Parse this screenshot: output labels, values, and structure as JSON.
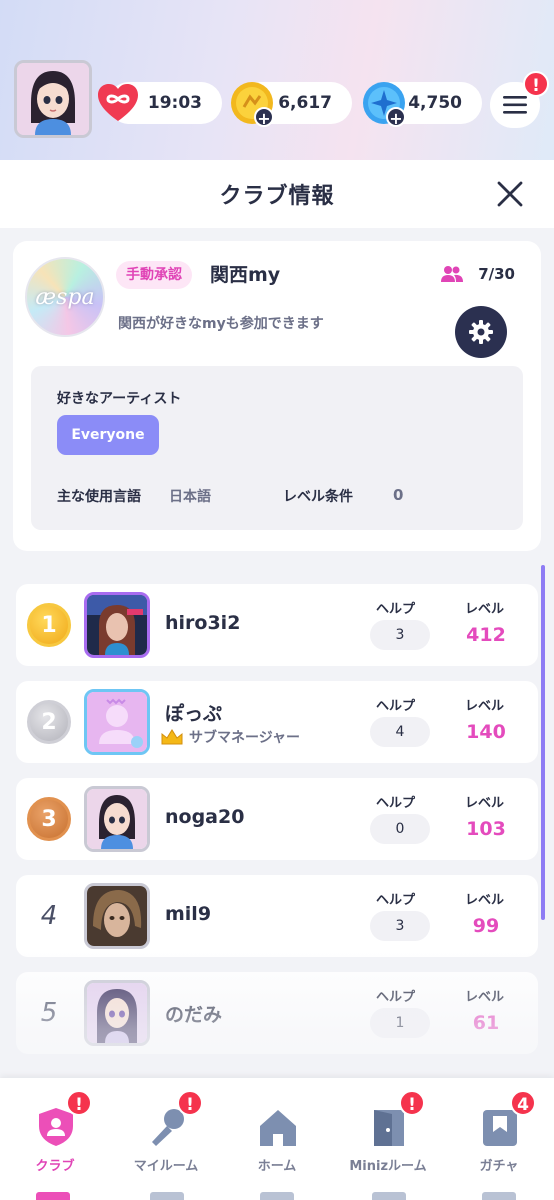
{
  "status": {
    "hearts": "19:03",
    "coins": "6,617",
    "gems": "4,750",
    "menu_alert": "!"
  },
  "sheet": {
    "title": "クラブ情報"
  },
  "club": {
    "logo_text": "æspa",
    "approval": "手動承認",
    "name": "関西my",
    "members": "7/30",
    "description": "関西が好きなmyも参加できます",
    "favorite_artist_label": "好きなアーティスト",
    "favorite_artist": "Everyone",
    "language_label": "主な使用言語",
    "language": "日本語",
    "level_req_label": "レベル条件",
    "level_req": "0"
  },
  "ranking": {
    "help_label": "ヘルプ",
    "level_label": "レベル",
    "rows": [
      {
        "rank": "1",
        "name": "hiro3i2",
        "help": "3",
        "level": "412"
      },
      {
        "rank": "2",
        "name": "ぽっぷ",
        "role": "サブマネージャー",
        "help": "4",
        "level": "140"
      },
      {
        "rank": "3",
        "name": "noga20",
        "help": "0",
        "level": "103"
      },
      {
        "rank": "4",
        "name": "mil9",
        "help": "3",
        "level": "99"
      },
      {
        "rank": "5",
        "name": "のだみ",
        "help": "1",
        "level": "61"
      }
    ]
  },
  "nav": {
    "items": [
      {
        "label": "クラブ",
        "badge": "!"
      },
      {
        "label": "マイルーム",
        "badge": "!"
      },
      {
        "label": "ホーム",
        "badge": ""
      },
      {
        "label": "Minizルーム",
        "badge": "!"
      },
      {
        "label": "ガチャ",
        "badge": "4"
      }
    ]
  },
  "colors": {
    "accent_pink": "#e044b6",
    "navy": "#2b3050",
    "artist_chip": "#8b8cf7",
    "alert_red": "#f5334d"
  }
}
